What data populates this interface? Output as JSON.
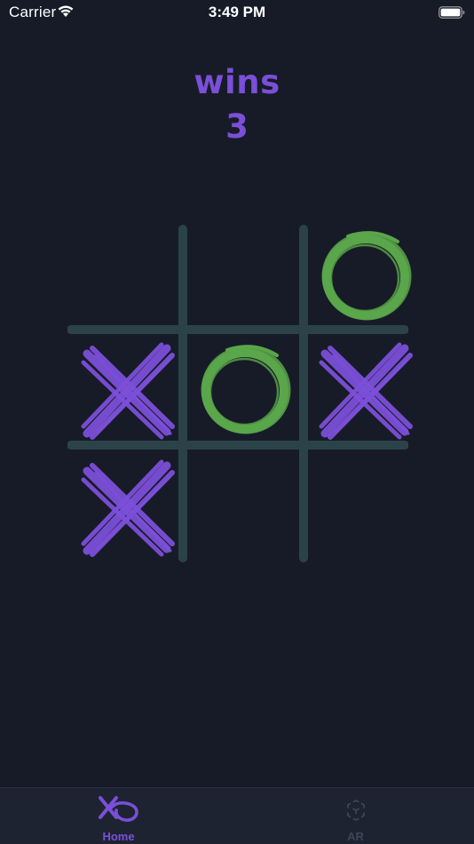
{
  "status_bar": {
    "carrier": "Carrier",
    "time": "3:49 PM",
    "wifi_icon": "wifi-icon",
    "battery_icon": "battery-icon"
  },
  "score": {
    "label": "wins",
    "count": "3"
  },
  "board": {
    "cells": [
      [
        "",
        "",
        "O"
      ],
      [
        "X",
        "O",
        "X"
      ],
      [
        "X",
        "",
        ""
      ]
    ],
    "x_color": "#7b4fd8",
    "o_color": "#5aa64a",
    "grid_color": "#2b4348"
  },
  "tab_bar": {
    "items": [
      {
        "label": "Home",
        "icon": "xo-logo-icon",
        "active": true
      },
      {
        "label": "AR",
        "icon": "ar-cube-icon",
        "active": false
      }
    ],
    "active_color": "#7b4fd8",
    "inactive_color": "#3e4454"
  },
  "colors": {
    "background": "#171b27",
    "tab_bar_background": "#1d2331"
  }
}
